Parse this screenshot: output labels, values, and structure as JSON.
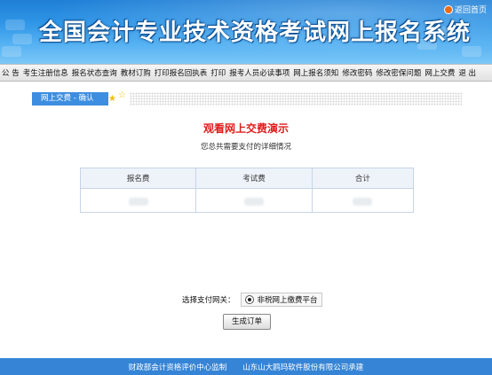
{
  "header": {
    "title": "全国会计专业技术资格考试网上报名系统",
    "home_link": "返回首页"
  },
  "nav": {
    "items": [
      "公 告",
      "考生注册信息",
      "报名状态查询",
      "教材订购",
      "打印报名回执表",
      "打印",
      "报考人员必读事项",
      "网上报名须知",
      "修改密码",
      "修改密保问题",
      "网上交费",
      "退 出"
    ]
  },
  "breadcrumb": {
    "label": "网上交费 - 确认"
  },
  "main": {
    "title": "观看网上交费演示",
    "subtitle": "您总共需要支付的详细情况",
    "table": {
      "headers": [
        "报名费",
        "考试费",
        "合计"
      ]
    },
    "gateway_label": "选择支付网关：",
    "gateway_option": "非税网上缴费平台",
    "submit_button": "生成订单"
  },
  "footer": {
    "left": "财政部会计资格评价中心监制",
    "right": "山东山大鸥玛软件股份有限公司承建"
  },
  "colors": {
    "header_blue": "#2f95e6",
    "footer_blue": "#3584d6",
    "title_red": "#e01b1b"
  }
}
